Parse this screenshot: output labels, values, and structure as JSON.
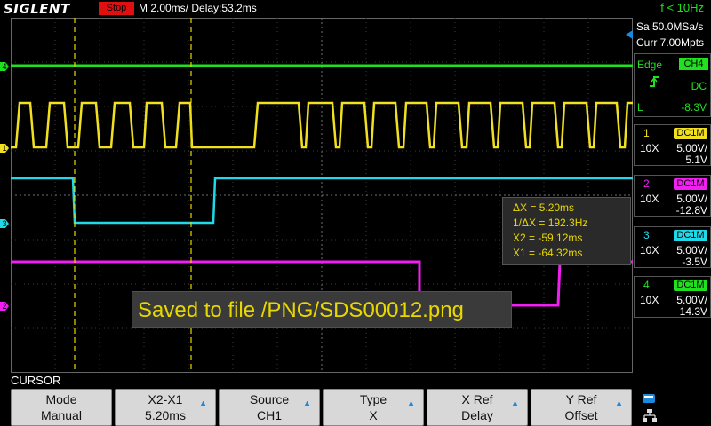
{
  "header": {
    "logo": "SIGLENT",
    "run_state": "Stop",
    "timebase": "M 2.00ms/ Delay:53.2ms",
    "frequency": "f < 10Hz"
  },
  "acquisition": {
    "sample_rate": "Sa 50.0MSa/s",
    "memory_depth": "Curr 7.00Mpts"
  },
  "trigger": {
    "mode_label": "Edge",
    "source": "CH4",
    "coupling": "DC",
    "level_prefix": "L",
    "level": "-8.3V",
    "slope_icon": "rising-edge-icon"
  },
  "channels": [
    {
      "number": "1",
      "coupling": "DC1M",
      "probe": "10X",
      "volts_div": "5.00V/",
      "offset": "5.1V",
      "color": "#f0e020"
    },
    {
      "number": "2",
      "coupling": "DC1M",
      "probe": "10X",
      "volts_div": "5.00V/",
      "offset": "-12.8V",
      "color": "#f020f0"
    },
    {
      "number": "3",
      "coupling": "DC1M",
      "probe": "10X",
      "volts_div": "5.00V/",
      "offset": "-3.5V",
      "color": "#20d8e8"
    },
    {
      "number": "4",
      "coupling": "DC1M",
      "probe": "10X",
      "volts_div": "5.00V/",
      "offset": "14.3V",
      "color": "#20e020"
    }
  ],
  "cursor_readout": {
    "delta_x": "ΔX = 5.20ms",
    "inv_delta_x": "1/ΔX = 192.3Hz",
    "x2": "X2 = -59.12ms",
    "x1": "X1 = -64.32ms"
  },
  "message": "Saved to file /PNG/SDS00012.png",
  "menu": {
    "title": "CURSOR",
    "softkeys": [
      {
        "line1": "Mode",
        "line2": "Manual",
        "arrow": false
      },
      {
        "line1": "X2-X1",
        "line2": "5.20ms",
        "arrow": true
      },
      {
        "line1": "Source",
        "line2": "CH1",
        "arrow": true
      },
      {
        "line1": "Type",
        "line2": "X",
        "arrow": true
      },
      {
        "line1": "X Ref",
        "line2": "Delay",
        "arrow": true
      },
      {
        "line1": "Y Ref",
        "line2": "Offset",
        "arrow": true
      }
    ]
  },
  "markers": {
    "ch4": "4",
    "ch1": "1",
    "ch3": "3",
    "ch2": "2"
  },
  "colors": {
    "grid": "#555555",
    "cursor": "#e8d800",
    "run_state_bg": "#e01010",
    "accent_green": "#20e020"
  }
}
